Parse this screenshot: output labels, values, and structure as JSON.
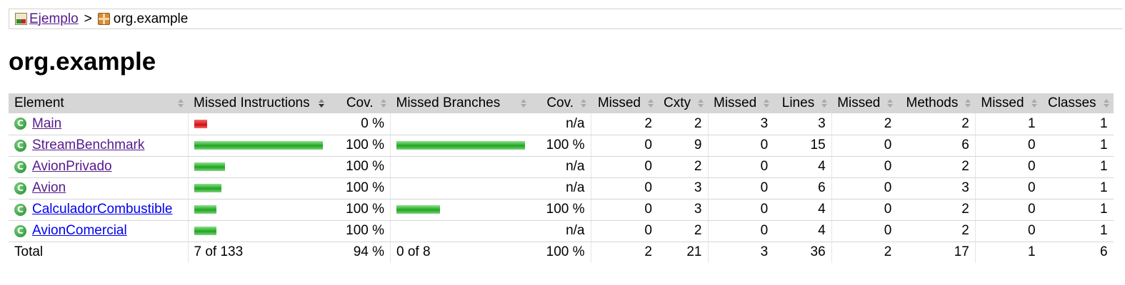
{
  "breadcrumb": {
    "root_icon": "report-icon",
    "root_label": "Ejemplo",
    "separator": ">",
    "pkg_icon": "package-icon",
    "pkg_label": "org.example"
  },
  "page_title": "org.example",
  "table": {
    "headers": [
      "Element",
      "Missed Instructions",
      "Cov.",
      "Missed Branches",
      "Cov.",
      "Missed",
      "Cxty",
      "Missed",
      "Lines",
      "Missed",
      "Methods",
      "Missed",
      "Classes"
    ],
    "sorted_column": "Missed Instructions",
    "colors": {
      "missed": "#d01010",
      "covered": "#1ea61e"
    },
    "rows": [
      {
        "icon": "class-icon",
        "name": "Main",
        "visited": true,
        "instr_missed_frac": 1.0,
        "instr_covered_frac": 0.0,
        "instr_cov": "0 %",
        "branch_missed_frac": 0,
        "branch_covered_frac": 0,
        "branch_cov": "n/a",
        "cxty_missed": "2",
        "cxty": "2",
        "lines_missed": "3",
        "lines": "3",
        "methods_missed": "2",
        "methods": "2",
        "classes_missed": "1",
        "classes": "1"
      },
      {
        "icon": "class-icon",
        "name": "StreamBenchmark",
        "visited": true,
        "instr_missed_frac": 0.0,
        "instr_covered_frac": 1.0,
        "instr_cov": "100 %",
        "branch_missed_frac": 0,
        "branch_covered_frac": 1.0,
        "branch_cov": "100 %",
        "cxty_missed": "0",
        "cxty": "9",
        "lines_missed": "0",
        "lines": "15",
        "methods_missed": "0",
        "methods": "6",
        "classes_missed": "0",
        "classes": "1"
      },
      {
        "icon": "class-icon",
        "name": "AvionPrivado",
        "visited": true,
        "instr_missed_frac": 0.0,
        "instr_covered_frac": 0.24,
        "instr_cov": "100 %",
        "branch_missed_frac": 0,
        "branch_covered_frac": 0,
        "branch_cov": "n/a",
        "cxty_missed": "0",
        "cxty": "2",
        "lines_missed": "0",
        "lines": "4",
        "methods_missed": "0",
        "methods": "2",
        "classes_missed": "0",
        "classes": "1"
      },
      {
        "icon": "class-icon",
        "name": "Avion",
        "visited": true,
        "instr_missed_frac": 0.0,
        "instr_covered_frac": 0.21,
        "instr_cov": "100 %",
        "branch_missed_frac": 0,
        "branch_covered_frac": 0,
        "branch_cov": "n/a",
        "cxty_missed": "0",
        "cxty": "3",
        "lines_missed": "0",
        "lines": "6",
        "methods_missed": "0",
        "methods": "3",
        "classes_missed": "0",
        "classes": "1"
      },
      {
        "icon": "class-icon",
        "name": "CalculadorCombustible",
        "visited": false,
        "instr_missed_frac": 0.0,
        "instr_covered_frac": 0.17,
        "instr_cov": "100 %",
        "branch_missed_frac": 0,
        "branch_covered_frac": 0.34,
        "branch_cov": "100 %",
        "cxty_missed": "0",
        "cxty": "3",
        "lines_missed": "0",
        "lines": "4",
        "methods_missed": "0",
        "methods": "2",
        "classes_missed": "0",
        "classes": "1"
      },
      {
        "icon": "class-icon",
        "name": "AvionComercial",
        "visited": false,
        "instr_missed_frac": 0.0,
        "instr_covered_frac": 0.17,
        "instr_cov": "100 %",
        "branch_missed_frac": 0,
        "branch_covered_frac": 0,
        "branch_cov": "n/a",
        "cxty_missed": "0",
        "cxty": "2",
        "lines_missed": "0",
        "lines": "4",
        "methods_missed": "0",
        "methods": "2",
        "classes_missed": "0",
        "classes": "1"
      }
    ],
    "total": {
      "label": "Total",
      "instr": "7 of 133",
      "instr_cov": "94 %",
      "branch": "0 of 8",
      "branch_cov": "100 %",
      "cxty_missed": "2",
      "cxty": "21",
      "lines_missed": "3",
      "lines": "36",
      "methods_missed": "2",
      "methods": "17",
      "classes_missed": "1",
      "classes": "6"
    }
  }
}
